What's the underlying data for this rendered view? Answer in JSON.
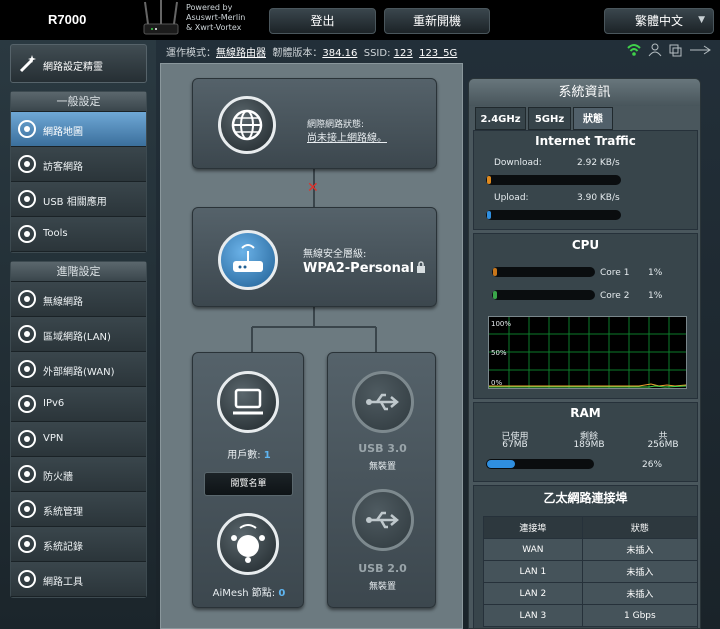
{
  "header": {
    "model": "R7000",
    "powered_line1": "Powered by",
    "powered_line2": "Asuswrt-Merlin",
    "powered_line3": "& Xwrt-Vortex",
    "logout_label": "登出",
    "reboot_label": "重新開機",
    "language": "繁體中文"
  },
  "statusbar": {
    "mode_label": "運作模式：",
    "mode_value": "無線路由器",
    "firmware_label": "韌體版本：",
    "firmware_value": "384.16",
    "ssid_label": "SSID:",
    "ssid_1": "123",
    "ssid_2": "123_5G"
  },
  "sidebar": {
    "qis_label": "網路設定精靈",
    "general_header": "一般設定",
    "general_items": [
      {
        "label": "網路地圖",
        "icon": "network-map-icon",
        "active": true
      },
      {
        "label": "訪客網路",
        "icon": "guest-network-icon"
      },
      {
        "label": "USB 相關應用",
        "icon": "usb-icon"
      },
      {
        "label": "Tools",
        "icon": "wrench-icon"
      }
    ],
    "advanced_header": "進階設定",
    "advanced_items": [
      {
        "label": "無線網路",
        "icon": "wireless-icon"
      },
      {
        "label": "區域網路(LAN)",
        "icon": "lan-icon"
      },
      {
        "label": "外部網路(WAN)",
        "icon": "wan-icon"
      },
      {
        "label": "IPv6",
        "icon": "ipv6-icon"
      },
      {
        "label": "VPN",
        "icon": "vpn-icon"
      },
      {
        "label": "防火牆",
        "icon": "firewall-icon"
      },
      {
        "label": "系統管理",
        "icon": "admin-icon"
      },
      {
        "label": "系統記錄",
        "icon": "syslog-icon"
      },
      {
        "label": "網路工具",
        "icon": "network-tools-icon"
      }
    ]
  },
  "map": {
    "internet_status_label": "網際網路狀態:",
    "internet_status_value": "尚未接上網路線。",
    "security_label": "無線安全層級:",
    "security_value": "WPA2-Personal",
    "clients_label": "用戶數:",
    "clients_count": "1",
    "blocklist_label": "閱覽名單",
    "aimesh_label": "AiMesh 節點:",
    "aimesh_count": "0",
    "usb1_label": "USB 3.0",
    "usb1_status": "無裝置",
    "usb2_label": "USB 2.0",
    "usb2_status": "無裝置"
  },
  "sysinfo": {
    "title": "系統資訊",
    "tabs": [
      "2.4GHz",
      "5GHz",
      "狀態"
    ],
    "traffic_title": "Internet Traffic",
    "download_label": "Download:",
    "download_value": "2.92 KB/s",
    "upload_label": "Upload:",
    "upload_value": "3.90 KB/s",
    "cpu_title": "CPU",
    "cores": [
      {
        "label": "Core 1",
        "value": "1%",
        "fraction": 0.01
      },
      {
        "label": "Core 2",
        "value": "1%",
        "fraction": 0.01
      }
    ],
    "graph_labels": [
      "100%",
      "50%",
      "0%"
    ],
    "ram_title": "RAM",
    "ram_used_label": "已使用",
    "ram_used_value": "67MB",
    "ram_free_label": "剩餘",
    "ram_free_value": "189MB",
    "ram_total_label": "共",
    "ram_total_value": "256MB",
    "ram_percent": "26%",
    "ram_fraction": 0.26,
    "eth_title": "乙太網路連接埠",
    "eth_headers": [
      "連接埠",
      "狀態"
    ],
    "eth_rows": [
      [
        "WAN",
        "未插入"
      ],
      [
        "LAN 1",
        "未插入"
      ],
      [
        "LAN 2",
        "未插入"
      ],
      [
        "LAN 3",
        "1 Gbps"
      ]
    ]
  },
  "colors": {
    "accent_blue": "#2f8fe0",
    "download_orange": "#e08a1e",
    "error_red": "#e0322a",
    "wifi_green": "#3fd14a"
  }
}
